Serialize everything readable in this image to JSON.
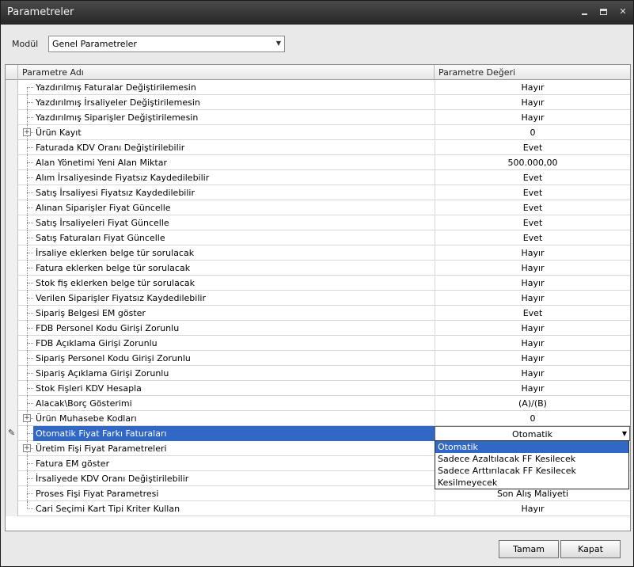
{
  "window": {
    "title": "Parametreler"
  },
  "modul": {
    "label": "Modül",
    "value": "Genel Parametreler"
  },
  "grid": {
    "headers": {
      "name": "Parametre Adı",
      "value": "Parametre Değeri"
    },
    "rows": [
      {
        "name": "Yazdırılmış Faturalar Değiştirilemesin",
        "value": "Hayır"
      },
      {
        "name": "Yazdırılmış İrsaliyeler Değiştirilemesin",
        "value": "Hayır"
      },
      {
        "name": "Yazdırılmış Siparişler Değiştirilemesin",
        "value": "Hayır"
      },
      {
        "name": "Ürün Kayıt",
        "value": "0",
        "expandable": true
      },
      {
        "name": "Faturada KDV Oranı Değiştirilebilir",
        "value": "Evet"
      },
      {
        "name": "Alan Yönetimi Yeni Alan Miktar",
        "value": "500.000,00"
      },
      {
        "name": "Alım İrsaliyesinde Fiyatsız Kaydedilebilir",
        "value": "Evet"
      },
      {
        "name": "Satış İrsaliyesi Fiyatsız Kaydedilebilir",
        "value": "Evet"
      },
      {
        "name": "Alınan Siparişler Fiyat Güncelle",
        "value": "Evet"
      },
      {
        "name": "Satış İrsaliyeleri Fiyat Güncelle",
        "value": "Evet"
      },
      {
        "name": "Satış Faturaları Fiyat Güncelle",
        "value": "Evet"
      },
      {
        "name": "İrsaliye eklerken belge tür sorulacak",
        "value": "Hayır"
      },
      {
        "name": "Fatura eklerken belge tür sorulacak",
        "value": "Hayır"
      },
      {
        "name": "Stok fiş eklerken belge tür sorulacak",
        "value": "Hayır"
      },
      {
        "name": "Verilen Siparişler Fiyatsız Kaydedilebilir",
        "value": "Hayır"
      },
      {
        "name": "Sipariş Belgesi EM göster",
        "value": "Evet"
      },
      {
        "name": "FDB Personel Kodu Girişi Zorunlu",
        "value": "Hayır"
      },
      {
        "name": "FDB Açıklama Girişi Zorunlu",
        "value": "Hayır"
      },
      {
        "name": "Sipariş Personel Kodu Girişi Zorunlu",
        "value": "Hayır"
      },
      {
        "name": "Sipariş Açıklama Girişi Zorunlu",
        "value": "Hayır"
      },
      {
        "name": "Stok Fişleri KDV Hesapla",
        "value": "Hayır"
      },
      {
        "name": "Alacak\\Borç Gösterimi",
        "value": "(A)/(B)"
      },
      {
        "name": "Ürün Muhasebe Kodları",
        "value": "0",
        "expandable": true
      },
      {
        "name": "Otomatik Fiyat Farkı Faturaları",
        "value": "Otomatik",
        "selected": true
      },
      {
        "name": "Üretim Fişi Fiyat Parametreleri",
        "value": "",
        "expandable": true
      },
      {
        "name": "Fatura EM göster",
        "value": ""
      },
      {
        "name": "İrsaliyede KDV Oranı Değiştirilebilir",
        "value": ""
      },
      {
        "name": "Proses Fişi Fiyat Parametresi",
        "value": "Son Alış Maliyeti"
      },
      {
        "name": "Cari Seçimi Kart Tipi Kriter Kullan",
        "value": "Hayır"
      }
    ]
  },
  "dropdown": {
    "options": [
      "Otomatik",
      "Sadece Azaltılacak FF Kesilecek",
      "Sadece Arttırılacak FF Kesilecek",
      "Kesilmeyecek"
    ],
    "highlighted": "Otomatik"
  },
  "buttons": {
    "ok": "Tamam",
    "cancel": "Kapat"
  },
  "colors": {
    "selection": "#3168c6",
    "titlebar": "#2f2f2f"
  },
  "icons": {
    "edit_row": "pencil-icon",
    "combo_arrow": "chevron-down-icon",
    "expander": "plus-icon"
  }
}
